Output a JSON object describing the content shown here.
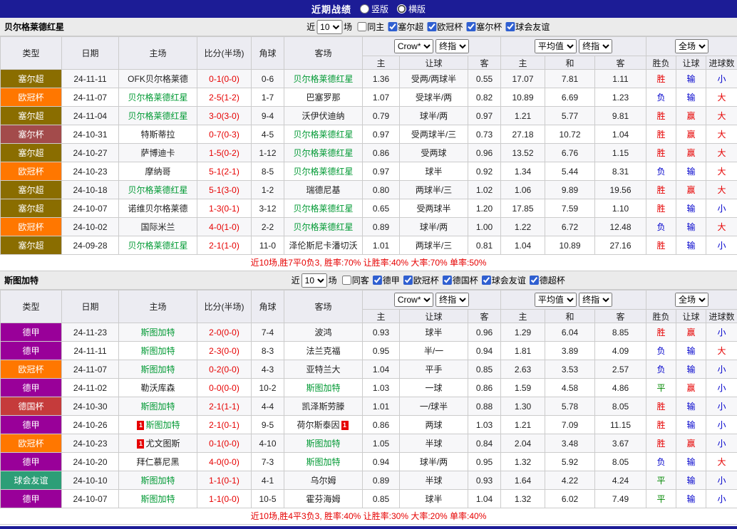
{
  "topbar": {
    "title": "近期战绩",
    "options": [
      {
        "label": "竖版",
        "selected": false
      },
      {
        "label": "横版",
        "selected": true
      }
    ]
  },
  "colors": {
    "topbar_bg": "#1c1c96",
    "score": "#e60000",
    "team_highlight": "#009933",
    "summary": "#e60000"
  },
  "league_colors": {
    "塞尔超": "#8a6d00",
    "欧冠杯": "#ff7700",
    "塞尔杯": "#a34b4b",
    "德甲": "#990099",
    "德国杯": "#c53b3b",
    "球会友谊": "#2d9e77"
  },
  "result_colors": {
    "胜": "#e60000",
    "平": "#008800",
    "负": "#0000cc",
    "赢": "#e60000",
    "输": "#0000cc",
    "大": "#e60000",
    "小": "#0000cc"
  },
  "sections": [
    {
      "team": "贝尔格莱德红星",
      "near_label": "近",
      "count_value": "10",
      "unit_label": "场",
      "same_label": "同主",
      "same_checked": false,
      "filters": [
        {
          "label": "塞尔超",
          "checked": true
        },
        {
          "label": "欧冠杯",
          "checked": true
        },
        {
          "label": "塞尔杯",
          "checked": true
        },
        {
          "label": "球会友谊",
          "checked": true
        }
      ],
      "header": {
        "static": [
          "类型",
          "日期",
          "主场",
          "比分(半场)",
          "角球",
          "客场"
        ],
        "g1a": "Crow*",
        "g1b": "终指",
        "g2a": "平均值",
        "g2b": "终指",
        "g3": "全场",
        "sub": [
          "主",
          "让球",
          "客",
          "主",
          "和",
          "客",
          "胜负",
          "让球",
          "进球数"
        ]
      },
      "rows": [
        {
          "league": "塞尔超",
          "date": "24-11-11",
          "home": "OFK贝尔格莱德",
          "home_hl": false,
          "home_card": "",
          "score": "0-1(0-0)",
          "corner": "0-6",
          "away": "贝尔格莱德红星",
          "away_hl": true,
          "away_card": "",
          "odds": [
            "1.36",
            "受两/两球半",
            "0.55",
            "17.07",
            "7.81",
            "1.11"
          ],
          "results": [
            "胜",
            "输",
            "小"
          ]
        },
        {
          "league": "欧冠杯",
          "date": "24-11-07",
          "home": "贝尔格莱德红星",
          "home_hl": true,
          "home_card": "",
          "score": "2-5(1-2)",
          "corner": "1-7",
          "away": "巴塞罗那",
          "away_hl": false,
          "away_card": "",
          "odds": [
            "1.07",
            "受球半/两",
            "0.82",
            "10.89",
            "6.69",
            "1.23"
          ],
          "results": [
            "负",
            "输",
            "大"
          ]
        },
        {
          "league": "塞尔超",
          "date": "24-11-04",
          "home": "贝尔格莱德红星",
          "home_hl": true,
          "home_card": "",
          "score": "3-0(3-0)",
          "corner": "9-4",
          "away": "沃伊伏迪纳",
          "away_hl": false,
          "away_card": "",
          "odds": [
            "0.79",
            "球半/两",
            "0.97",
            "1.21",
            "5.77",
            "9.81"
          ],
          "results": [
            "胜",
            "赢",
            "大"
          ]
        },
        {
          "league": "塞尔杯",
          "date": "24-10-31",
          "home": "特斯蒂拉",
          "home_hl": false,
          "home_card": "",
          "score": "0-7(0-3)",
          "corner": "4-5",
          "away": "贝尔格莱德红星",
          "away_hl": true,
          "away_card": "",
          "odds": [
            "0.97",
            "受两球半/三",
            "0.73",
            "27.18",
            "10.72",
            "1.04"
          ],
          "results": [
            "胜",
            "赢",
            "大"
          ]
        },
        {
          "league": "塞尔超",
          "date": "24-10-27",
          "home": "萨博迪卡",
          "home_hl": false,
          "home_card": "",
          "score": "1-5(0-2)",
          "corner": "1-12",
          "away": "贝尔格莱德红星",
          "away_hl": true,
          "away_card": "",
          "odds": [
            "0.86",
            "受两球",
            "0.96",
            "13.52",
            "6.76",
            "1.15"
          ],
          "results": [
            "胜",
            "赢",
            "大"
          ]
        },
        {
          "league": "欧冠杯",
          "date": "24-10-23",
          "home": "摩纳哥",
          "home_hl": false,
          "home_card": "",
          "score": "5-1(2-1)",
          "corner": "8-5",
          "away": "贝尔格莱德红星",
          "away_hl": true,
          "away_card": "",
          "odds": [
            "0.97",
            "球半",
            "0.92",
            "1.34",
            "5.44",
            "8.31"
          ],
          "results": [
            "负",
            "输",
            "大"
          ]
        },
        {
          "league": "塞尔超",
          "date": "24-10-18",
          "home": "贝尔格莱德红星",
          "home_hl": true,
          "home_card": "",
          "score": "5-1(3-0)",
          "corner": "1-2",
          "away": "瑞德尼基",
          "away_hl": false,
          "away_card": "",
          "odds": [
            "0.80",
            "两球半/三",
            "1.02",
            "1.06",
            "9.89",
            "19.56"
          ],
          "results": [
            "胜",
            "赢",
            "大"
          ]
        },
        {
          "league": "塞尔超",
          "date": "24-10-07",
          "home": "诺维贝尔格莱德",
          "home_hl": false,
          "home_card": "",
          "score": "1-3(0-1)",
          "corner": "3-12",
          "away": "贝尔格莱德红星",
          "away_hl": true,
          "away_card": "",
          "odds": [
            "0.65",
            "受两球半",
            "1.20",
            "17.85",
            "7.59",
            "1.10"
          ],
          "results": [
            "胜",
            "输",
            "小"
          ]
        },
        {
          "league": "欧冠杯",
          "date": "24-10-02",
          "home": "国际米兰",
          "home_hl": false,
          "home_card": "",
          "score": "4-0(1-0)",
          "corner": "2-2",
          "away": "贝尔格莱德红星",
          "away_hl": true,
          "away_card": "",
          "odds": [
            "0.89",
            "球半/两",
            "1.00",
            "1.22",
            "6.72",
            "12.48"
          ],
          "results": [
            "负",
            "输",
            "大"
          ]
        },
        {
          "league": "塞尔超",
          "date": "24-09-28",
          "home": "贝尔格莱德红星",
          "home_hl": true,
          "home_card": "",
          "score": "2-1(1-0)",
          "corner": "11-0",
          "away": "泽伦斯尼卡潘切沃",
          "away_hl": false,
          "away_card": "",
          "odds": [
            "1.01",
            "两球半/三",
            "0.81",
            "1.04",
            "10.89",
            "27.16"
          ],
          "results": [
            "胜",
            "输",
            "小"
          ]
        }
      ],
      "summary": "近10场,胜7平0负3, 胜率:70% 让胜率:40% 大率:70% 单率:50%"
    },
    {
      "team": "斯图加特",
      "near_label": "近",
      "count_value": "10",
      "unit_label": "场",
      "same_label": "同客",
      "same_checked": false,
      "filters": [
        {
          "label": "德甲",
          "checked": true
        },
        {
          "label": "欧冠杯",
          "checked": true
        },
        {
          "label": "德国杯",
          "checked": true
        },
        {
          "label": "球会友谊",
          "checked": true
        },
        {
          "label": "德超杯",
          "checked": true
        }
      ],
      "header": {
        "static": [
          "类型",
          "日期",
          "主场",
          "比分(半场)",
          "角球",
          "客场"
        ],
        "g1a": "Crow*",
        "g1b": "终指",
        "g2a": "平均值",
        "g2b": "终指",
        "g3": "全场",
        "sub": [
          "主",
          "让球",
          "客",
          "主",
          "和",
          "客",
          "胜负",
          "让球",
          "进球数"
        ]
      },
      "rows": [
        {
          "league": "德甲",
          "date": "24-11-23",
          "home": "斯图加特",
          "home_hl": true,
          "home_card": "",
          "score": "2-0(0-0)",
          "corner": "7-4",
          "away": "波鸿",
          "away_hl": false,
          "away_card": "",
          "odds": [
            "0.93",
            "球半",
            "0.96",
            "1.29",
            "6.04",
            "8.85"
          ],
          "results": [
            "胜",
            "赢",
            "小"
          ]
        },
        {
          "league": "德甲",
          "date": "24-11-11",
          "home": "斯图加特",
          "home_hl": true,
          "home_card": "",
          "score": "2-3(0-0)",
          "corner": "8-3",
          "away": "法兰克福",
          "away_hl": false,
          "away_card": "",
          "odds": [
            "0.95",
            "半/一",
            "0.94",
            "1.81",
            "3.89",
            "4.09"
          ],
          "results": [
            "负",
            "输",
            "大"
          ]
        },
        {
          "league": "欧冠杯",
          "date": "24-11-07",
          "home": "斯图加特",
          "home_hl": true,
          "home_card": "",
          "score": "0-2(0-0)",
          "corner": "4-3",
          "away": "亚特兰大",
          "away_hl": false,
          "away_card": "",
          "odds": [
            "1.04",
            "平手",
            "0.85",
            "2.63",
            "3.53",
            "2.57"
          ],
          "results": [
            "负",
            "输",
            "小"
          ]
        },
        {
          "league": "德甲",
          "date": "24-11-02",
          "home": "勒沃库森",
          "home_hl": false,
          "home_card": "",
          "score": "0-0(0-0)",
          "corner": "10-2",
          "away": "斯图加特",
          "away_hl": true,
          "away_card": "",
          "odds": [
            "1.03",
            "一球",
            "0.86",
            "1.59",
            "4.58",
            "4.86"
          ],
          "results": [
            "平",
            "赢",
            "小"
          ]
        },
        {
          "league": "德国杯",
          "date": "24-10-30",
          "home": "斯图加特",
          "home_hl": true,
          "home_card": "",
          "score": "2-1(1-1)",
          "corner": "4-4",
          "away": "凯泽斯劳滕",
          "away_hl": false,
          "away_card": "",
          "odds": [
            "1.01",
            "一/球半",
            "0.88",
            "1.30",
            "5.78",
            "8.05"
          ],
          "results": [
            "胜",
            "输",
            "小"
          ]
        },
        {
          "league": "德甲",
          "date": "24-10-26",
          "home": "斯图加特",
          "home_hl": true,
          "home_card": "1",
          "score": "2-1(0-1)",
          "corner": "9-5",
          "away": "荷尔斯泰因",
          "away_hl": false,
          "away_card": "1",
          "odds": [
            "0.86",
            "两球",
            "1.03",
            "1.21",
            "7.09",
            "11.15"
          ],
          "results": [
            "胜",
            "输",
            "小"
          ]
        },
        {
          "league": "欧冠杯",
          "date": "24-10-23",
          "home": "尤文图斯",
          "home_hl": false,
          "home_card": "1",
          "score": "0-1(0-0)",
          "corner": "4-10",
          "away": "斯图加特",
          "away_hl": true,
          "away_card": "",
          "odds": [
            "1.05",
            "半球",
            "0.84",
            "2.04",
            "3.48",
            "3.67"
          ],
          "results": [
            "胜",
            "赢",
            "小"
          ]
        },
        {
          "league": "德甲",
          "date": "24-10-20",
          "home": "拜仁慕尼黑",
          "home_hl": false,
          "home_card": "",
          "score": "4-0(0-0)",
          "corner": "7-3",
          "away": "斯图加特",
          "away_hl": true,
          "away_card": "",
          "odds": [
            "0.94",
            "球半/两",
            "0.95",
            "1.32",
            "5.92",
            "8.05"
          ],
          "results": [
            "负",
            "输",
            "大"
          ]
        },
        {
          "league": "球会友谊",
          "date": "24-10-10",
          "home": "斯图加特",
          "home_hl": true,
          "home_card": "",
          "score": "1-1(0-1)",
          "corner": "4-1",
          "away": "乌尔姆",
          "away_hl": false,
          "away_card": "",
          "odds": [
            "0.89",
            "半球",
            "0.93",
            "1.64",
            "4.22",
            "4.24"
          ],
          "results": [
            "平",
            "输",
            "小"
          ]
        },
        {
          "league": "德甲",
          "date": "24-10-07",
          "home": "斯图加特",
          "home_hl": true,
          "home_card": "",
          "score": "1-1(0-0)",
          "corner": "10-5",
          "away": "霍芬海姆",
          "away_hl": false,
          "away_card": "",
          "odds": [
            "0.85",
            "球半",
            "1.04",
            "1.32",
            "6.02",
            "7.49"
          ],
          "results": [
            "平",
            "输",
            "小"
          ]
        }
      ],
      "summary": "近10场,胜4平3负3, 胜率:40% 让胜率:30% 大率:20% 单率:40%"
    }
  ]
}
